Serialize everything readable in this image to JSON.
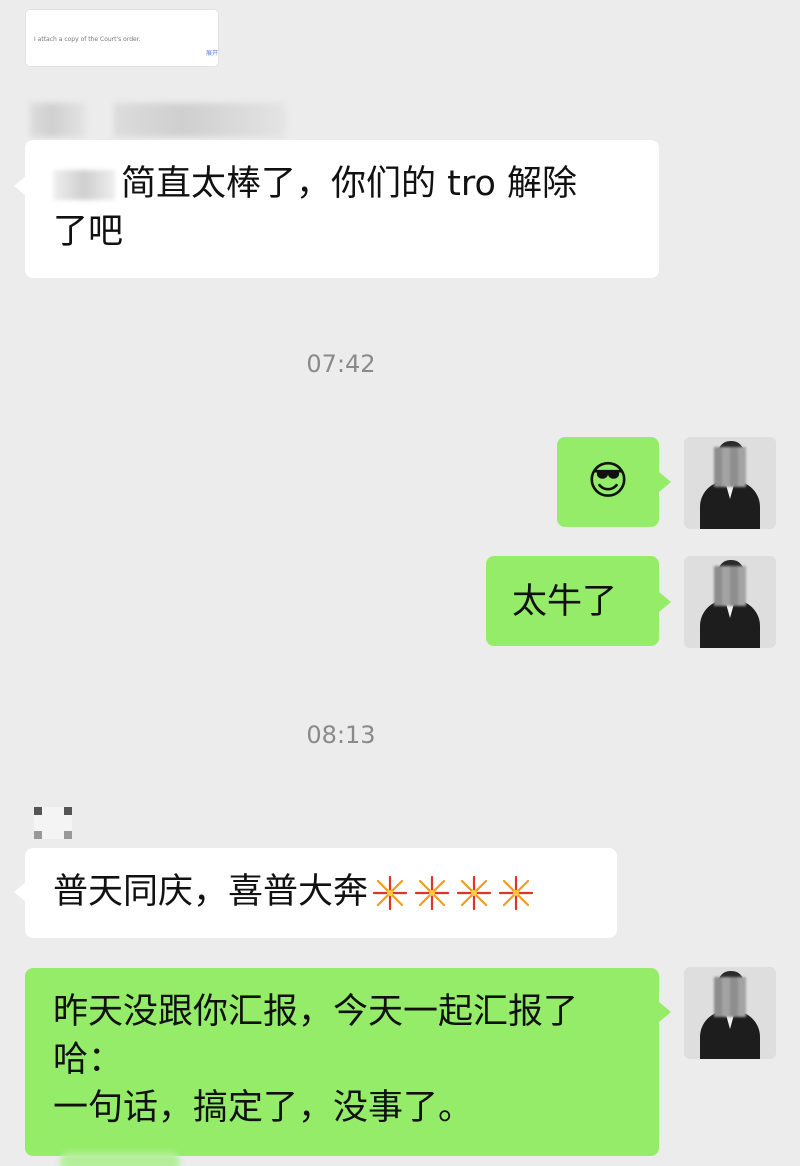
{
  "forwarded_card": {
    "text": "I attach a copy of the Court's order.",
    "badge": "展开"
  },
  "timestamps": [
    "07:42",
    "08:13"
  ],
  "messages": {
    "m1": {
      "side": "left",
      "line1": "简直太棒了，你们的 tro 解除",
      "line2": "了吧"
    },
    "m2": {
      "side": "right",
      "emoji": "😎"
    },
    "m3": {
      "side": "right",
      "text": "太牛了"
    },
    "m4": {
      "side": "left",
      "text": "普天同庆，喜普大奔",
      "emoji_count": 4,
      "emoji_name": "fireworks-icon"
    },
    "m5": {
      "side": "right",
      "line1": "昨天没跟你汇报，今天一起汇报了",
      "line2": "哈：",
      "line3": "一句话，搞定了，没事了。"
    }
  },
  "colors": {
    "background": "#ececec",
    "incoming_bubble": "#ffffff",
    "outgoing_bubble": "#95ec69",
    "timestamp_text": "#8a8a8a"
  }
}
